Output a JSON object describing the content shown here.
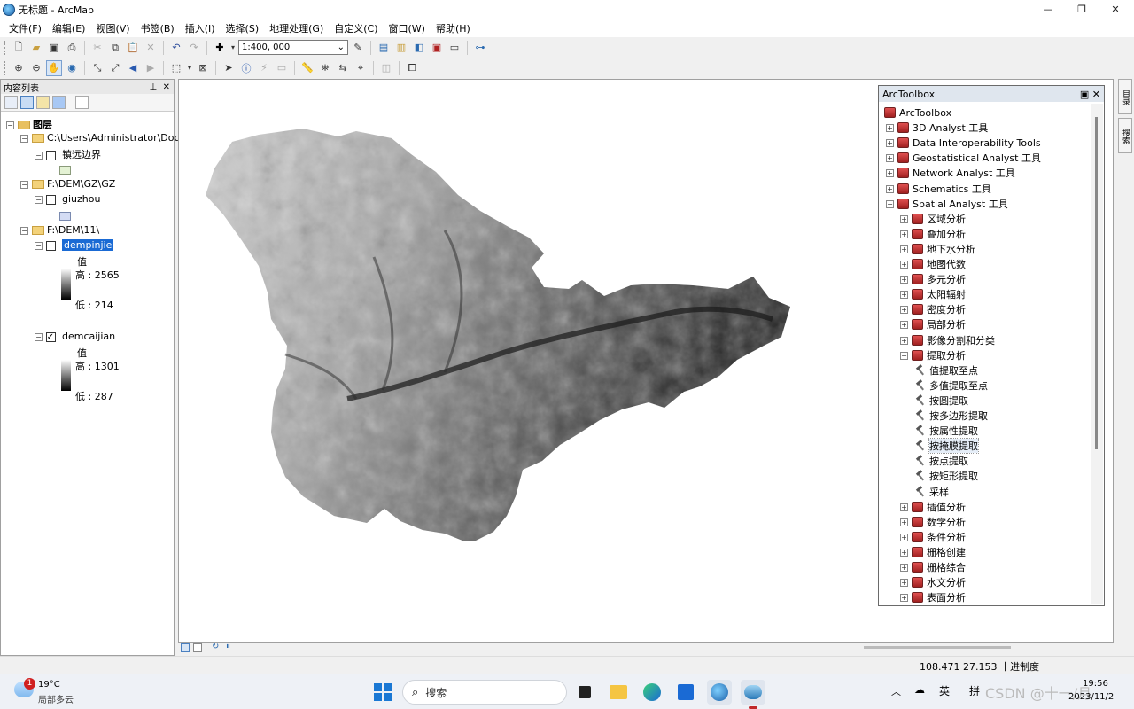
{
  "window": {
    "title": "无标题 - ArcMap"
  },
  "menu": [
    "文件(F)",
    "编辑(E)",
    "视图(V)",
    "书签(B)",
    "插入(I)",
    "选择(S)",
    "地理处理(G)",
    "自定义(C)",
    "窗口(W)",
    "帮助(H)"
  ],
  "toolbar": {
    "scale": "1:400, 000"
  },
  "toc": {
    "title": "内容列表",
    "root": "图层",
    "groups": [
      {
        "path": "C:\\Users\\Administrator\\Doc",
        "layer": "镇远边界"
      },
      {
        "path": "F:\\DEM\\GZ\\GZ",
        "layer": "giuzhou"
      },
      {
        "path": "F:\\DEM\\11\\",
        "layers": [
          {
            "name": "dempinjie",
            "value_label": "值",
            "high": "高 : 2565",
            "low": "低 : 214"
          },
          {
            "name": "demcaijian",
            "value_label": "值",
            "high": "高 : 1301",
            "low": "低 : 287"
          }
        ]
      }
    ]
  },
  "toolbox": {
    "title": "ArcToolbox",
    "root": "ArcToolbox",
    "top_items": [
      "3D Analyst 工具",
      "Data Interoperability Tools",
      "Geostatistical Analyst 工具",
      "Network Analyst 工具",
      "Schematics 工具",
      "Spatial Analyst 工具"
    ],
    "spatial_items": [
      "区域分析",
      "叠加分析",
      "地下水分析",
      "地图代数",
      "多元分析",
      "太阳辐射",
      "密度分析",
      "局部分析",
      "影像分割和分类",
      "提取分析"
    ],
    "extract_tools": [
      "值提取至点",
      "多值提取至点",
      "按圆提取",
      "按多边形提取",
      "按属性提取",
      "按掩膜提取",
      "按点提取",
      "按矩形提取",
      "采样"
    ],
    "more_items": [
      "插值分析",
      "数学分析",
      "条件分析",
      "栅格创建",
      "栅格综合",
      "水文分析",
      "表面分析"
    ]
  },
  "side_tabs": [
    "目录",
    "搜索"
  ],
  "status": {
    "coords": "108.471  27.153 十进制度"
  },
  "taskbar": {
    "temp": "19°C",
    "weather": "局部多云",
    "badge": "1",
    "search": "搜索",
    "ime": "英",
    "ime2": "拼",
    "time": "19:56",
    "date": "2023/11/2",
    "watermark": "CSDN @十一/月"
  }
}
